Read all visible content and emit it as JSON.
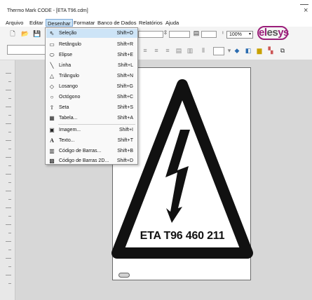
{
  "window": {
    "title": "Thermo Mark CODE - [ETA T96.cdm]"
  },
  "menubar": [
    {
      "id": "arquivo",
      "label": "Arquivo"
    },
    {
      "id": "editar",
      "label": "Editar"
    },
    {
      "id": "desenhar",
      "label": "Desenhar",
      "open": true
    },
    {
      "id": "formatar",
      "label": "Formatar"
    },
    {
      "id": "banco",
      "label": "Banco de Dados"
    },
    {
      "id": "relatorios",
      "label": "Relatórios"
    },
    {
      "id": "ajuda",
      "label": "Ajuda"
    }
  ],
  "toolbar": {
    "zoom": "100%",
    "logo_el": "el",
    "logo_es": "es",
    "logo_ys": "ys"
  },
  "dropdown": {
    "items": [
      {
        "label": "Seleção",
        "shortcut": "Shift+O",
        "icon": "pointer-icon",
        "glyph": "⇖",
        "highlighted": true
      },
      {
        "label": "Retângulo",
        "shortcut": "Shift+R",
        "icon": "rectangle-icon",
        "glyph": "▭"
      },
      {
        "label": "Elipse",
        "shortcut": "Shift+E",
        "icon": "ellipse-icon",
        "glyph": "⬭"
      },
      {
        "label": "Linha",
        "shortcut": "Shift+L",
        "icon": "line-icon",
        "glyph": "╲"
      },
      {
        "label": "Triângulo",
        "shortcut": "Shift+N",
        "icon": "triangle-icon",
        "glyph": "△"
      },
      {
        "label": "Losango",
        "shortcut": "Shift+G",
        "icon": "diamond-icon",
        "glyph": "◇"
      },
      {
        "label": "Octógono",
        "shortcut": "Shift+C",
        "icon": "octagon-icon",
        "glyph": "○"
      },
      {
        "label": "Seta",
        "shortcut": "Shift+S",
        "icon": "arrow-icon",
        "glyph": "⇧"
      },
      {
        "label": "Tabela...",
        "shortcut": "Shift+A",
        "icon": "table-icon",
        "glyph": "▦"
      },
      {
        "label": "Imagem...",
        "shortcut": "Shift+I",
        "icon": "image-icon",
        "glyph": "▣",
        "separator_before": true
      },
      {
        "label": "Texto...",
        "shortcut": "Shift+T",
        "icon": "text-icon",
        "glyph": "A"
      },
      {
        "label": "Código de Barras...",
        "shortcut": "Shift+B",
        "icon": "barcode-icon",
        "glyph": "▥"
      },
      {
        "label": "Código de Barras 2D...",
        "shortcut": "Shift+D",
        "icon": "qrcode-icon",
        "glyph": "▩"
      }
    ]
  },
  "label": {
    "code_text": "ETA T96 460 211"
  },
  "colors": {
    "accent": "#9b1e7a",
    "highlight": "#cde4f7",
    "canvas": "#ffffff",
    "workspace": "#d7d7d7"
  }
}
